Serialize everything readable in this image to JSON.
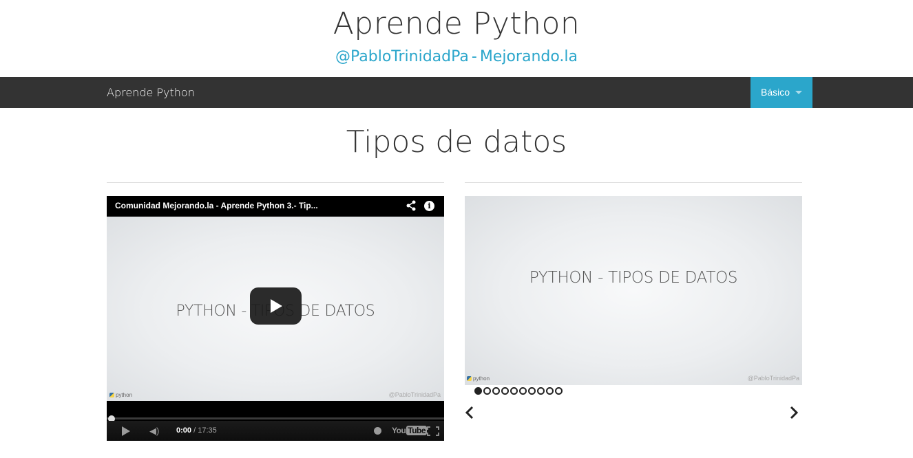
{
  "header": {
    "title": "Aprende Python",
    "twitter_link": "@PabloTrinidadPa",
    "separator": "-",
    "site_link": "Mejorando.la"
  },
  "navbar": {
    "brand": "Aprende Python",
    "dropdown_label": "Básico",
    "bg_color": "#333333",
    "accent_color": "#2ba6cb"
  },
  "main": {
    "heading": "Tipos de datos"
  },
  "video": {
    "title": "Comunidad Mejorando.la - Aprende Python 3.- Tip...",
    "slide_text": "PYTHON - TIPOS DE DATOS",
    "python_logo_text": "python",
    "handle": "@PabloTrinidadPa",
    "current_time": "0:00",
    "duration": "/ 17:35",
    "youtube_logo_you": "You",
    "youtube_logo_tube": "Tube",
    "progress_fraction": 0,
    "icons": [
      "share-icon",
      "info-icon",
      "play-icon",
      "volume-icon",
      "clock-icon",
      "youtube-logo",
      "fullscreen-icon"
    ]
  },
  "slides": {
    "slide_text": "PYTHON - TIPOS DE DATOS",
    "python_logo_text": "python",
    "handle": "@PabloTrinidadPa",
    "total_slides": 10,
    "current_slide": 1,
    "icons": [
      "prev-arrow-icon",
      "next-arrow-icon"
    ]
  }
}
